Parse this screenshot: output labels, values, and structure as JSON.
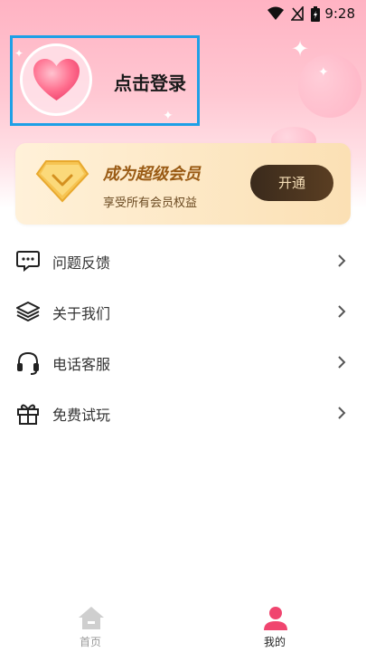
{
  "status_bar": {
    "time": "9:28",
    "icons": [
      "wifi-icon",
      "signal-icon",
      "battery-icon"
    ]
  },
  "profile": {
    "login_label": "点击登录",
    "avatar_icon": "heart-icon"
  },
  "vip": {
    "title": "成为超级会员",
    "subtitle": "享受所有会员权益",
    "button": "开通"
  },
  "menu": [
    {
      "icon": "feedback-icon",
      "label": "问题反馈"
    },
    {
      "icon": "layers-icon",
      "label": "关于我们"
    },
    {
      "icon": "headset-icon",
      "label": "电话客服"
    },
    {
      "icon": "gift-icon",
      "label": "免费试玩"
    }
  ],
  "tabbar": {
    "items": [
      {
        "icon": "home-icon",
        "label": "首页",
        "active": false
      },
      {
        "icon": "person-icon",
        "label": "我的",
        "active": true
      }
    ]
  },
  "colors": {
    "accent": "#f0456f",
    "vip_text": "#9a5b15",
    "highlight_border": "#1ea0e6"
  }
}
